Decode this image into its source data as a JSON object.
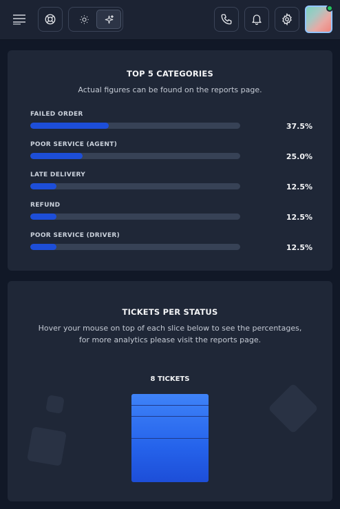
{
  "header": {
    "icons": [
      "menu-icon",
      "lifebuoy-icon",
      "sun-icon",
      "sparkles-icon",
      "phone-icon",
      "bell-icon",
      "gear-icon"
    ],
    "avatar_status_color": "#22c55e"
  },
  "categories_card": {
    "title": "TOP 5 CATEGORIES",
    "subtitle": "Actual figures can be found on the reports page.",
    "items": [
      {
        "label": "FAILED ORDER",
        "value": 37.5,
        "display": "37.5%"
      },
      {
        "label": "POOR SERVICE (AGENT)",
        "value": 25.0,
        "display": "25.0%"
      },
      {
        "label": "LATE DELIVERY",
        "value": 12.5,
        "display": "12.5%"
      },
      {
        "label": "REFUND",
        "value": 12.5,
        "display": "12.5%"
      },
      {
        "label": "POOR SERVICE (DRIVER)",
        "value": 12.5,
        "display": "12.5%"
      }
    ],
    "accent": "#1d4ed8"
  },
  "status_card": {
    "title": "TICKETS PER STATUS",
    "subtitle_line1": "Hover your mouse on top of each slice below to see the percentages,",
    "subtitle_line2": "for more analytics please visit the reports page.",
    "total_label": "8 TICKETS",
    "total": 8,
    "slices": [
      {
        "count": 1
      },
      {
        "count": 1
      },
      {
        "count": 2
      },
      {
        "count": 4
      }
    ]
  }
}
